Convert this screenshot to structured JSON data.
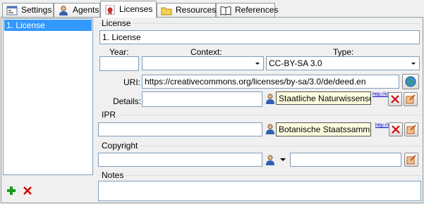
{
  "tabs": [
    {
      "label": "Settings",
      "icon": "settings-icon"
    },
    {
      "label": "Agents",
      "icon": "agents-icon"
    },
    {
      "label": "Licenses",
      "icon": "licenses-icon",
      "active": true
    },
    {
      "label": "Resources",
      "icon": "folder-icon"
    },
    {
      "label": "References",
      "icon": "book-icon"
    }
  ],
  "list": {
    "items": [
      "1. License"
    ],
    "selected": "1. License"
  },
  "license": {
    "group_title": "License",
    "name": "1. License",
    "year_label": "Year:",
    "context_label": "Context:",
    "type_label": "Type:",
    "year_value": "",
    "context_value": "",
    "type_value": "CC-BY-SA 3.0",
    "uri_label": "URI:",
    "uri_value": "https://creativecommons.org/licenses/by-sa/3.0/de/deed.en",
    "details_label": "Details:",
    "details_value": "",
    "agent_value": "Staatliche Naturwissenschaftl",
    "link_text": "http://id.s"
  },
  "ipr": {
    "group_title": "IPR",
    "value": "",
    "agent_value": "Botanische Staatssammlung",
    "link_text": "http://id.s"
  },
  "copyright": {
    "group_title": "Copyright",
    "value": "",
    "agent_value": ""
  },
  "notes": {
    "group_title": "Notes",
    "value": ""
  },
  "colors": {
    "selection": "#3399ff",
    "agent_bg": "#ffffe1",
    "add": "#1a9a1a",
    "remove": "#d40000"
  }
}
